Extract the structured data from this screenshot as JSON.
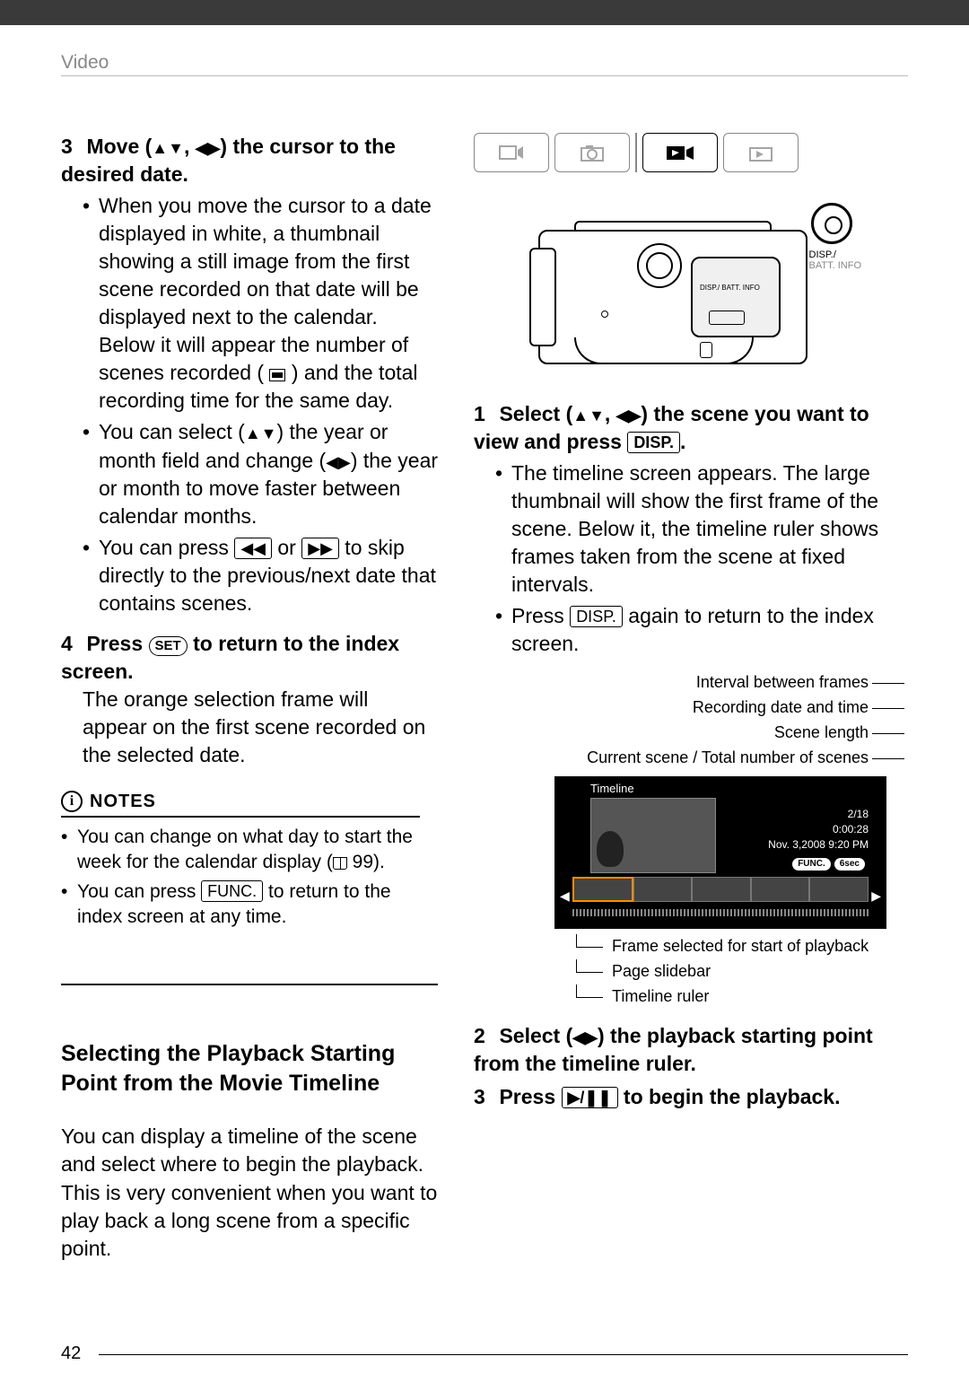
{
  "header": {
    "section": "Video"
  },
  "page_number": "42",
  "left": {
    "step3": {
      "num": "3",
      "title_a": "Move (",
      "title_b": ", ",
      "title_c": ") the cursor to the desired date.",
      "b1": "When you move the cursor to a date displayed in white, a thumbnail showing a still image from the first scene recorded on that date will be displayed next to the calendar. Below it will appear the number of scenes recorded ( ",
      "b1b": " ) and the total recording time for the same day.",
      "b2a": "You can select (",
      "b2b": ") the year or month field and change (",
      "b2c": ") the year or month to move faster between calendar months.",
      "b3a": "You can press ",
      "b3b": " or ",
      "b3c": " to skip directly to the previous/next date that contains scenes."
    },
    "step4": {
      "num": "4",
      "title_a": "Press ",
      "title_b": " to return to the index screen.",
      "body": "The orange selection frame will appear on the first scene recorded on the selected date."
    },
    "notes": {
      "label": "NOTES",
      "n1a": "You can change on what day to start the week for the calendar display (",
      "n1b": " 99).",
      "n2a": "You can press ",
      "n2b": " to return to the index screen at any time."
    },
    "section_title": "Selecting the Playback Starting Point from the Movie Timeline",
    "section_body": "You can display a timeline of the scene and select where to begin the playback. This is very convenient when you want to play back a long scene from a specific point."
  },
  "right": {
    "cam_label1": "DISP.",
    "cam_label2": "BATT. INFO",
    "cam_inner": "DISP./\nBATT. INFO",
    "step1": {
      "num": "1",
      "title_a": "Select (",
      "title_b": ", ",
      "title_c": ") the scene you want to view and press ",
      "title_d": ".",
      "b1": "The timeline screen appears. The large thumbnail will show the first frame of the scene. Below it, the timeline ruler shows frames taken from the scene at fixed intervals.",
      "b2a": "Press ",
      "b2b": " again to return to the index screen."
    },
    "tl": {
      "l1": "Interval between frames",
      "l2": "Recording date and time",
      "l3": "Scene length",
      "l4": "Current scene / Total number of scenes",
      "screen_title": "Timeline",
      "meta1": "2/18",
      "meta2": "0:00:28",
      "meta3": "Nov.  3,2008  9:20 PM",
      "pill1": "FUNC.",
      "pill2": "6sec",
      "bl1": "Frame selected for start of playback",
      "bl2": "Page slidebar",
      "bl3": "Timeline ruler"
    },
    "step2": {
      "num": "2",
      "title_a": "Select (",
      "title_b": ") the playback starting point from the timeline ruler."
    },
    "step3": {
      "num": "3",
      "title_a": "Press ",
      "title_b": " to begin the playback."
    }
  },
  "buttons": {
    "disp": "DISP.",
    "func": "FUNC.",
    "set": "SET"
  }
}
